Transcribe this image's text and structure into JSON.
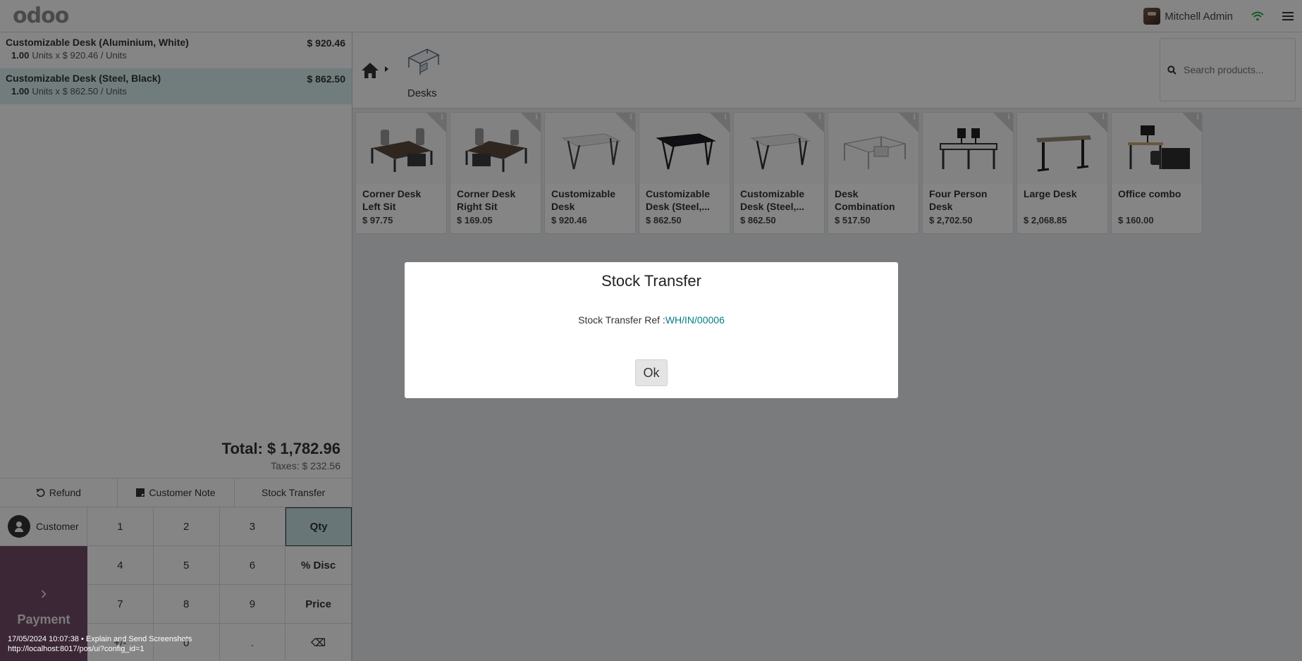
{
  "header": {
    "logo": "odoo",
    "user_name": "Mitchell Admin"
  },
  "order": {
    "lines": [
      {
        "name": "Customizable Desk (Aluminium, White)",
        "price": "$ 920.46",
        "qty": "1.00",
        "info": "Units x $ 920.46 / Units"
      },
      {
        "name": "Customizable Desk (Steel, Black)",
        "price": "$ 862.50",
        "qty": "1.00",
        "info": "Units x $ 862.50 / Units"
      }
    ],
    "total": "Total: $ 1,782.96",
    "taxes": "Taxes: $ 232.56"
  },
  "controls": {
    "refund": "Refund",
    "customer_note": "Customer Note",
    "stock_transfer": "Stock Transfer"
  },
  "pad": {
    "customer": "Customer",
    "payment": "Payment",
    "keys": [
      "1",
      "2",
      "3",
      "Qty",
      "4",
      "5",
      "6",
      "% Disc",
      "7",
      "8",
      "9",
      "Price",
      "+/-",
      "0",
      ".",
      "⌫"
    ]
  },
  "category": {
    "label": "Desks"
  },
  "search": {
    "placeholder": "Search products..."
  },
  "products": [
    {
      "name": "Corner Desk Left Sit",
      "price": "$ 97.75"
    },
    {
      "name": "Corner Desk Right Sit",
      "price": "$ 169.05"
    },
    {
      "name": "Customizable Desk (Aluminiu...",
      "price": "$ 920.46"
    },
    {
      "name": "Customizable Desk (Steel,...",
      "price": "$ 862.50"
    },
    {
      "name": "Customizable Desk (Steel,...",
      "price": "$ 862.50"
    },
    {
      "name": "Desk Combination",
      "price": "$ 517.50"
    },
    {
      "name": "Four Person Desk",
      "price": "$ 2,702.50"
    },
    {
      "name": "Large Desk",
      "price": "$ 2,068.85"
    },
    {
      "name": "Office combo",
      "price": "$ 160.00"
    }
  ],
  "modal": {
    "title": "Stock Transfer",
    "ref_label": "Stock Transfer Ref :",
    "ref_value": "WH/IN/00006",
    "ok": "Ok"
  },
  "debug": {
    "line1": "17/05/2024 10:07:38 • Explain and Send Screenshots",
    "line2": "http://localhost:8017/pos/ui?config_id=1"
  },
  "colors": {
    "payment": "#714b67",
    "selected_line": "#d9eef0",
    "link": "#017e84"
  }
}
